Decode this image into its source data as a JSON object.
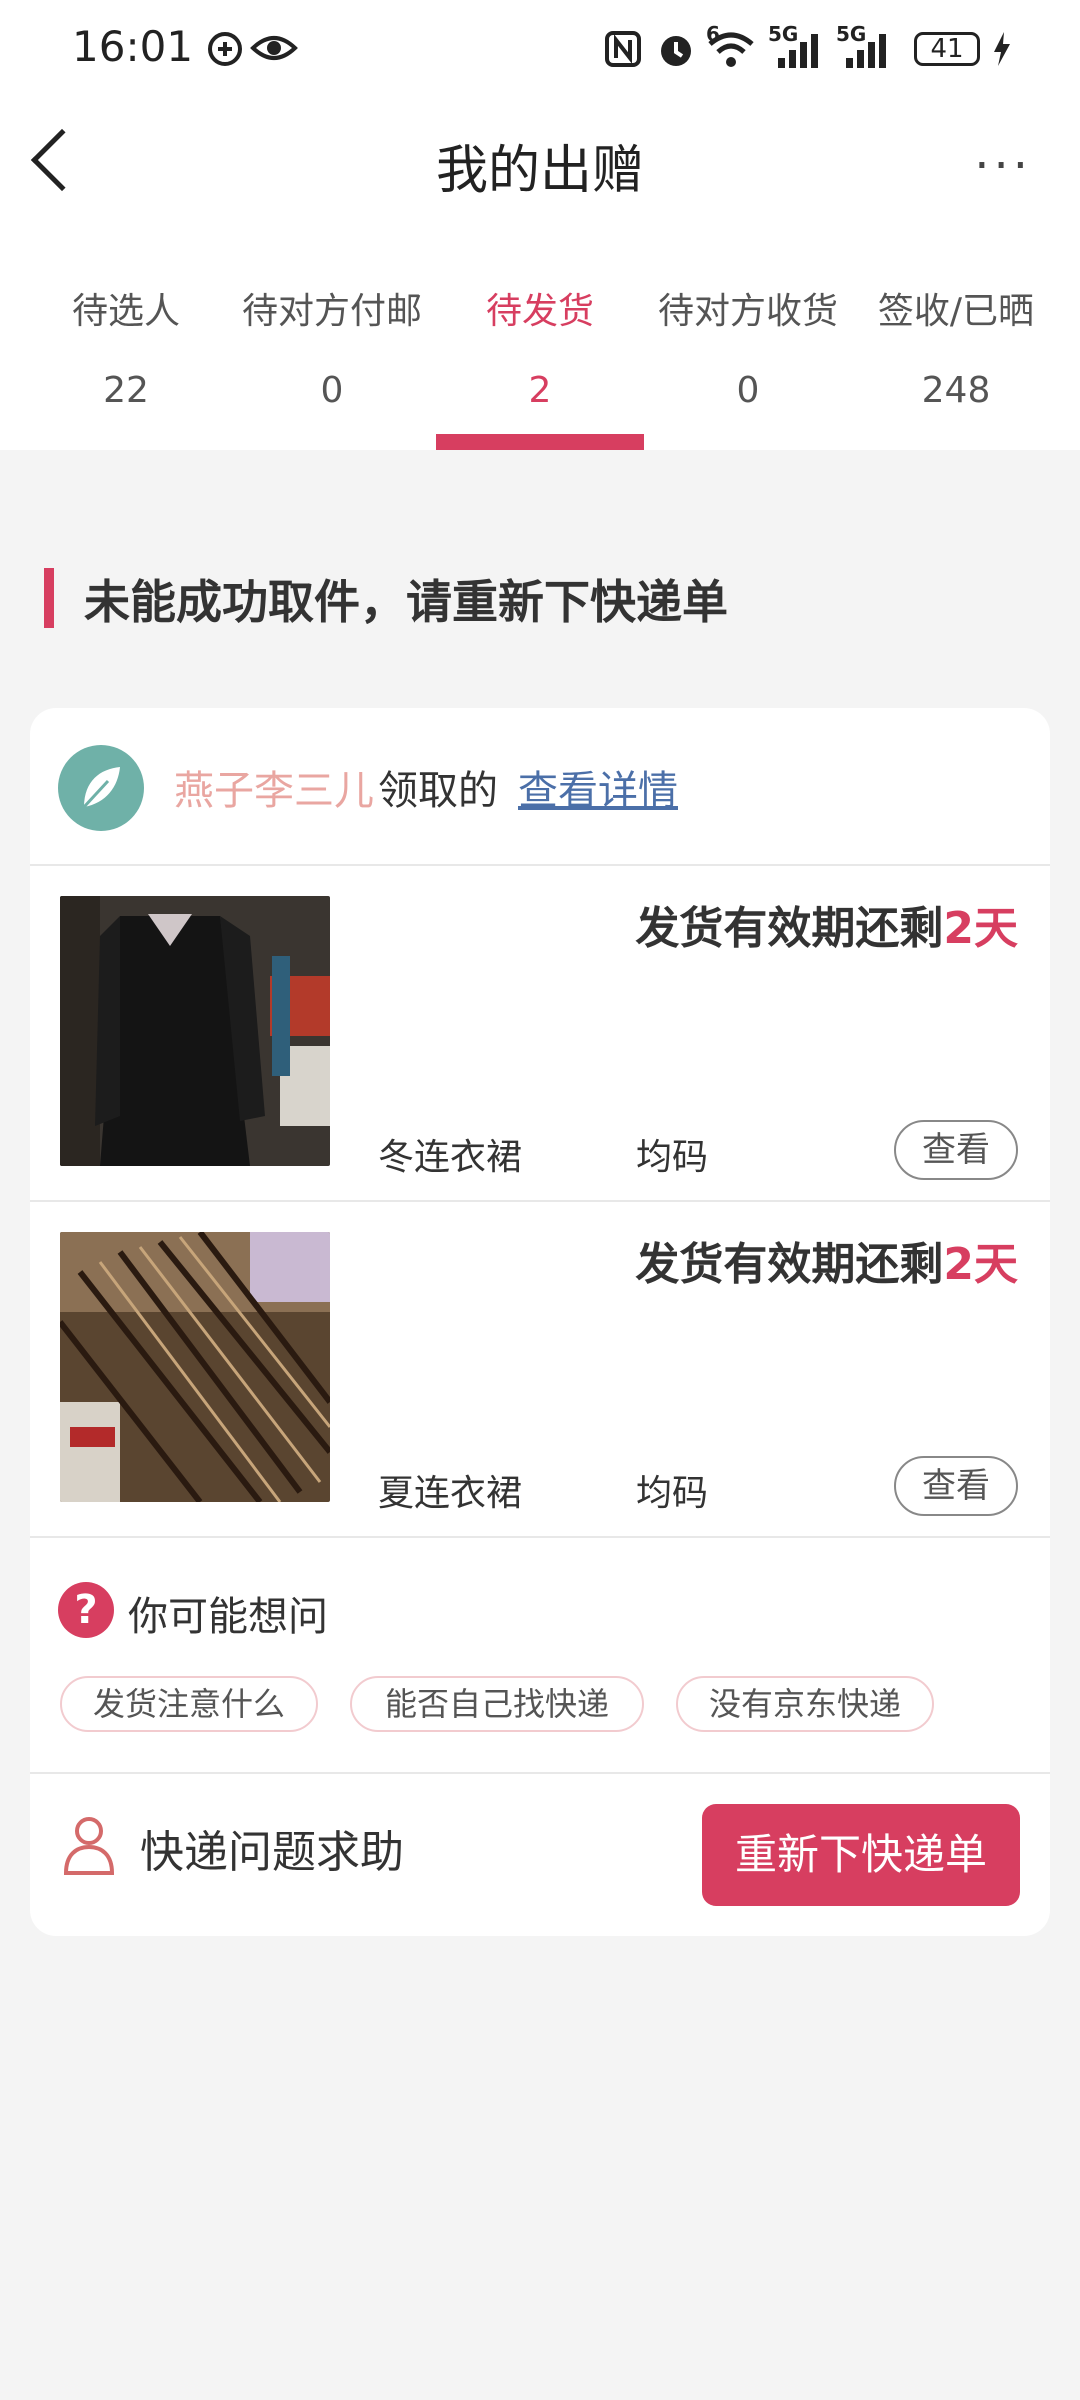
{
  "status_bar": {
    "time": "16:01",
    "icons": [
      "data-saver-icon",
      "eye-icon",
      "nfc-icon",
      "alarm-icon",
      "wifi-6-icon",
      "signal-5g-icon",
      "signal-5g-icon"
    ],
    "wifi_label": "6",
    "network1": "5G",
    "network2": "5G",
    "battery": "41"
  },
  "header": {
    "title": "我的出赠",
    "more": "···"
  },
  "tabs": [
    {
      "label": "待选人",
      "count": "22",
      "active": false
    },
    {
      "label": "待对方付邮",
      "count": "0",
      "active": false
    },
    {
      "label": "待发货",
      "count": "2",
      "active": true
    },
    {
      "label": "待对方收货",
      "count": "0",
      "active": false
    },
    {
      "label": "签收/已晒",
      "count": "248",
      "active": false
    }
  ],
  "section": {
    "title": "未能成功取件，请重新下快递单"
  },
  "order": {
    "recipient_name": "燕子李三儿",
    "recipient_suffix": "领取的",
    "detail_link": "查看详情",
    "items": [
      {
        "deadline_prefix": "发货有效期还剩",
        "deadline_value": "2天",
        "name": "冬连衣裙",
        "size": "均码",
        "view_label": "查看"
      },
      {
        "deadline_prefix": "发货有效期还剩",
        "deadline_value": "2天",
        "name": "夏连衣裙",
        "size": "均码",
        "view_label": "查看"
      }
    ]
  },
  "faq": {
    "icon": "?",
    "title": "你可能想问",
    "chips": [
      "发货注意什么",
      "能否自己找快递",
      "没有京东快递"
    ]
  },
  "footer": {
    "help_label": "快递问题求助",
    "reship_button": "重新下快递单"
  },
  "colors": {
    "accent": "#d73e60",
    "recipient": "#e9a6a1",
    "link": "#4b6fa8",
    "background": "#f4f4f4"
  }
}
